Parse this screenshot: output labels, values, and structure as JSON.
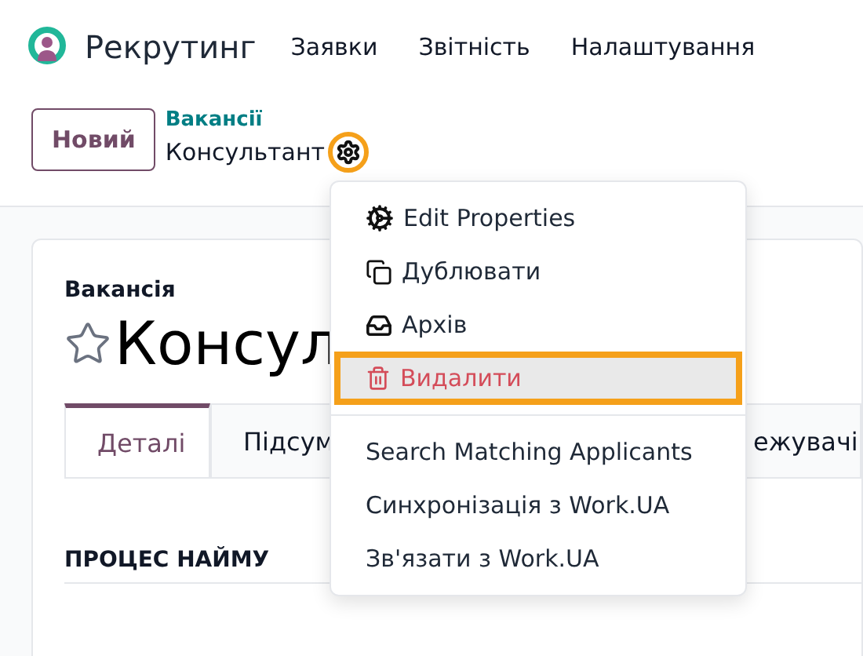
{
  "app": {
    "name": "Рекрутинг",
    "menu": [
      "Заявки",
      "Звітність",
      "Налаштування"
    ]
  },
  "control_panel": {
    "new_button": "Новий",
    "breadcrumb": "Вакансії",
    "record": "Консультант",
    "gear_highlighted": true
  },
  "form": {
    "label": "Вакансія",
    "title": "Консул",
    "starred": false,
    "tabs": [
      {
        "label": "Деталі",
        "selected": true
      },
      {
        "label": "Підсум",
        "selected": false
      },
      {
        "label": "ежувачі",
        "selected": false
      }
    ],
    "section": "ПРОЦЕС НАЙМУ"
  },
  "dropdown": {
    "groups": [
      [
        {
          "kind": "properties",
          "label": "Edit Properties",
          "highlighted": false
        },
        {
          "kind": "duplicate",
          "label": "Дублювати",
          "highlighted": false
        },
        {
          "kind": "archive",
          "label": "Архів",
          "highlighted": false
        },
        {
          "kind": "delete",
          "label": "Видалити",
          "highlighted": true
        }
      ],
      [
        {
          "kind": "plain",
          "label": "Search Matching Applicants",
          "highlighted": false
        },
        {
          "kind": "plain",
          "label": "Синхронізація з Work.UA",
          "highlighted": false
        },
        {
          "kind": "plain",
          "label": "Зв'язати з Work.UA",
          "highlighted": false
        }
      ]
    ]
  }
}
